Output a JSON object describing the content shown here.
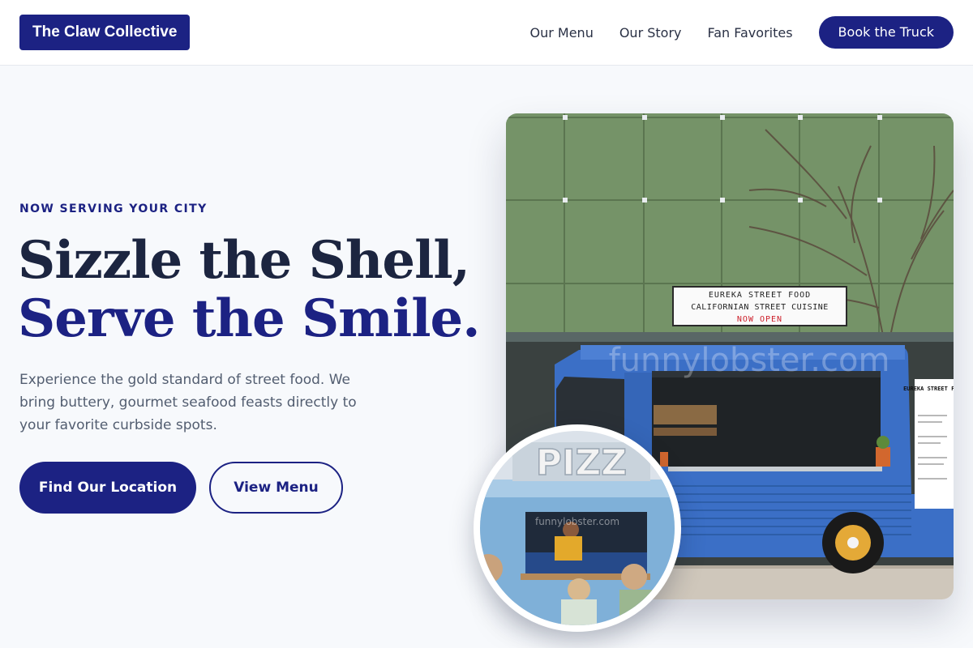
{
  "header": {
    "brand": "The Claw Collective",
    "nav": [
      {
        "label": "Our Menu"
      },
      {
        "label": "Our Story"
      },
      {
        "label": "Fan Favorites"
      }
    ],
    "cta_label": "Book the Truck"
  },
  "hero": {
    "eyebrow": "NOW SERVING YOUR CITY",
    "headline_line1": "Sizzle the Shell,",
    "headline_line2": "Serve the Smile.",
    "lede": "Experience the gold standard of street food. We bring buttery, gourmet seafood feasts directly to your favorite curbside spots.",
    "primary_button": "Find Our Location",
    "secondary_button": "View Menu"
  },
  "photo_main": {
    "sign_line1": "EUREKA STREET FOOD",
    "sign_line2": "CALIFORNIAN STREET CUISINE",
    "sign_line3": "NOW OPEN",
    "menu_board_title": "EUREKA STREET FOOD",
    "watermark": "funnylobster.com"
  },
  "photo_inset": {
    "sign": "PIZZ",
    "watermark": "funnylobster.com"
  },
  "colors": {
    "primary": "#1c2283",
    "headline_dark": "#1c2540",
    "body_text": "#525d70",
    "page_bg": "#f7f9fc"
  }
}
